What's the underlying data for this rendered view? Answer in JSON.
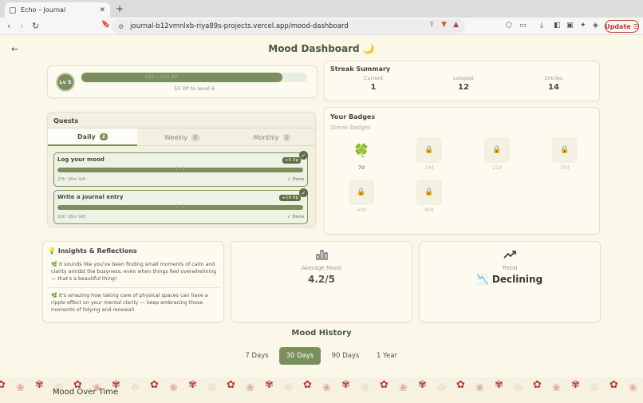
{
  "browser": {
    "tab_title": "Echo – Journal",
    "tab_close": "✕",
    "new_tab": "+",
    "url": "journal-b12vmnlxb-riya89s-projects.vercel.app/mood-dashboard",
    "update_label": "Update"
  },
  "page": {
    "title": "Mood Dashboard 🌙",
    "back": "←"
  },
  "level": {
    "label": "Lv 5",
    "xp_text": "445 / 500 XP",
    "xp_progress": 0.89,
    "sub": "55 XP to level 6"
  },
  "streak": {
    "title": "Streak Summary",
    "items": [
      {
        "label": "Current",
        "value": "1"
      },
      {
        "label": "Longest",
        "value": "12"
      },
      {
        "label": "Entries",
        "value": "14"
      }
    ]
  },
  "quests": {
    "title": "Quests",
    "tabs": [
      {
        "label": "Daily",
        "count": "2"
      },
      {
        "label": "Weekly",
        "count": "2"
      },
      {
        "label": "Monthly",
        "count": "1"
      }
    ],
    "items": [
      {
        "name": "Log your mood",
        "xp": "+5 Xp",
        "progress": "1 / 1",
        "time_left": "20h 18m left",
        "status": "✓ Done"
      },
      {
        "name": "Write a journal entry",
        "xp": "+10 Xp",
        "progress": "1 / 1",
        "time_left": "20h 18m left",
        "status": "✓ Done"
      }
    ]
  },
  "badges": {
    "title": "Your Badges",
    "subtitle": "Streak Badges",
    "items": [
      "7d",
      "14d",
      "21d",
      "30d",
      "60d",
      "90d"
    ]
  },
  "insights": {
    "title": "💡 Insights & Reflections",
    "items": [
      "🌿 It sounds like you've been finding small moments of calm and clarity amidst the busyness, even when things feel overwhelming — that's a beautiful thing!",
      "🌿 It's amazing how taking care of physical spaces can have a ripple effect on your mental clarity — keep embracing those moments of tidying and renewal!"
    ]
  },
  "average": {
    "label": "Average Mood",
    "value": "4.2/5"
  },
  "trend": {
    "label": "Trend",
    "value": "📉 Declining"
  },
  "history": {
    "title": "Mood History",
    "ranges": [
      "7 Days",
      "30 Days",
      "90 Days",
      "1 Year"
    ],
    "active": "30 Days"
  },
  "chart_heading": "Mood Over Time"
}
